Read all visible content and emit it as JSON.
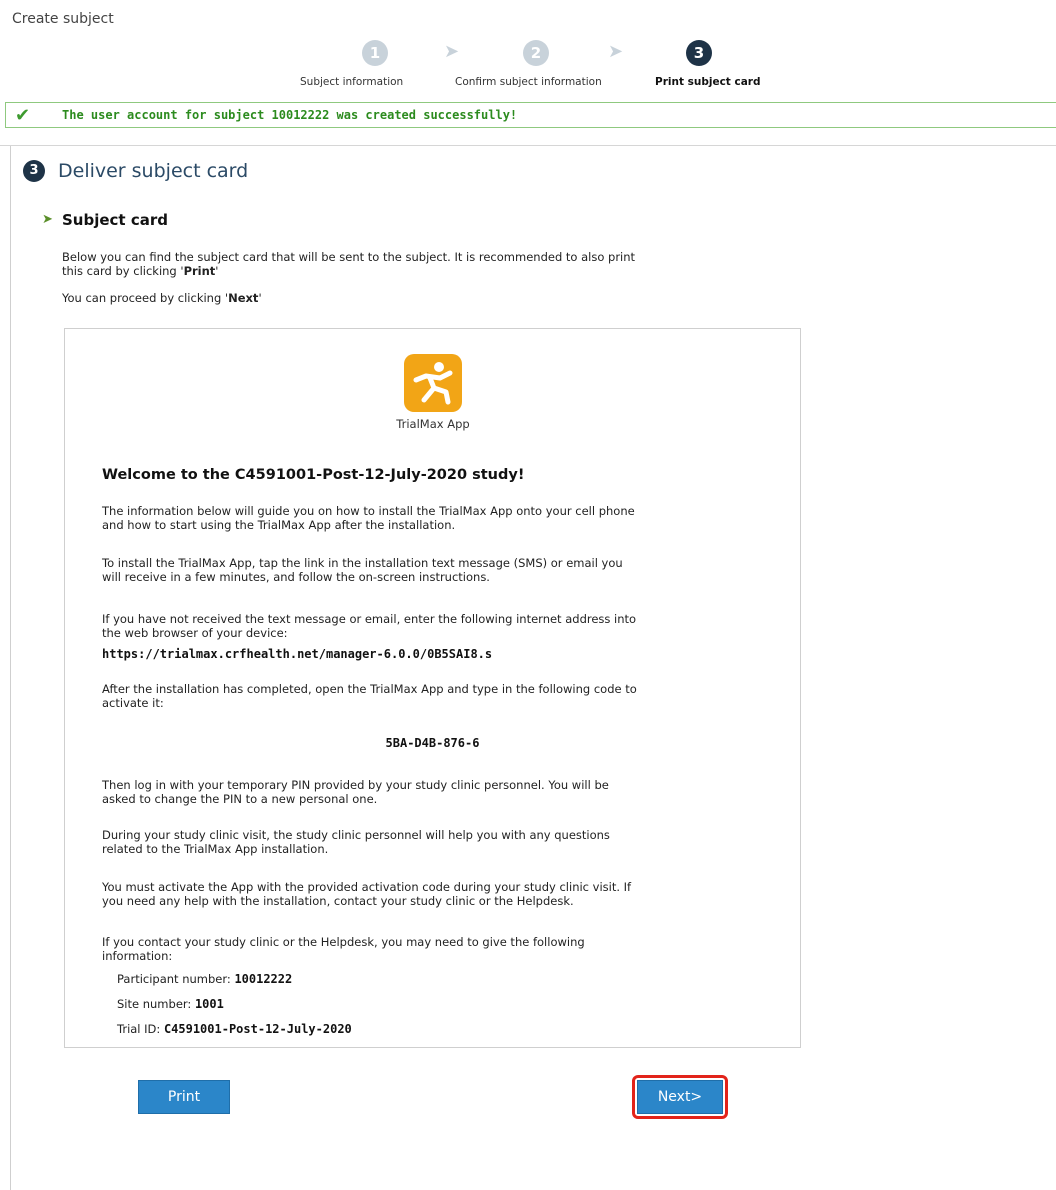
{
  "page": {
    "title": "Create subject"
  },
  "wizard": {
    "steps": [
      {
        "number": "1",
        "label": "Subject information",
        "state": "inactive"
      },
      {
        "number": "2",
        "label": "Confirm subject information",
        "state": "inactive"
      },
      {
        "number": "3",
        "label": "Print subject card",
        "state": "active"
      }
    ]
  },
  "alert": {
    "icon": "checkmark-icon",
    "message": "The user account for subject 10012222 was created successfully!"
  },
  "section": {
    "number": "3",
    "title": "Deliver subject card"
  },
  "subsection": {
    "title": "Subject card",
    "intro_1a": "Below you can find the subject card that will be sent to the subject. It is recommended to also print",
    "intro_1b": "this card by clicking '",
    "intro_1_bold": "Print",
    "intro_1c": "'",
    "intro_2a": "You can proceed by clicking '",
    "intro_2_bold": "Next",
    "intro_2c": "'"
  },
  "card": {
    "app_icon": "trialmax-runner-icon",
    "app_name": "TrialMax App",
    "heading": "Welcome to the C4591001-Post-12-July-2020 study!",
    "p1a": "The information below will guide you on how to install the TrialMax App onto your cell phone",
    "p1b": "and how to start using the TrialMax App after the installation.",
    "p2a": "To install the TrialMax App, tap the link in the installation text message (SMS) or email you",
    "p2b": "will receive in a few minutes, and follow the on-screen instructions.",
    "p3a": "If you have not received the text message or email, enter the following internet address into",
    "p3b": "the web browser of your device:",
    "url": "https://trialmax.crfhealth.net/manager-6.0.0/0B5SAI8.s",
    "p4a": "After the installation has completed, open the TrialMax App and type in the following code to",
    "p4b": "activate it:",
    "activation_code": "5BA-D4B-876-6",
    "p5a": "Then log in with your temporary PIN provided by your study clinic personnel. You will be",
    "p5b": "asked to change the PIN to a new personal one.",
    "p6a": "During your study clinic visit, the study clinic personnel will help you with any questions",
    "p6b": "related to the TrialMax App installation.",
    "p7a": "You must activate the App with the provided activation code during your study clinic visit. If",
    "p7b": "you need any help with the installation, contact your study clinic or the Helpdesk.",
    "p8a": "If you contact your study clinic or the Helpdesk, you may need to give the following",
    "p8b": "information:",
    "participant_label": "Participant number:",
    "participant_value": "10012222",
    "site_label": "Site number:",
    "site_value": "1001",
    "trial_label": "Trial ID:",
    "trial_value": "C4591001-Post-12-July-2020"
  },
  "buttons": {
    "print": "Print",
    "next": "Next>"
  },
  "colors": {
    "accent": "#2b86c9",
    "success": "#2c8b1e",
    "highlight": "#e2231a",
    "step_active": "#1e3347",
    "step_inactive": "#c8d2da",
    "app_icon": "#f2a516"
  }
}
